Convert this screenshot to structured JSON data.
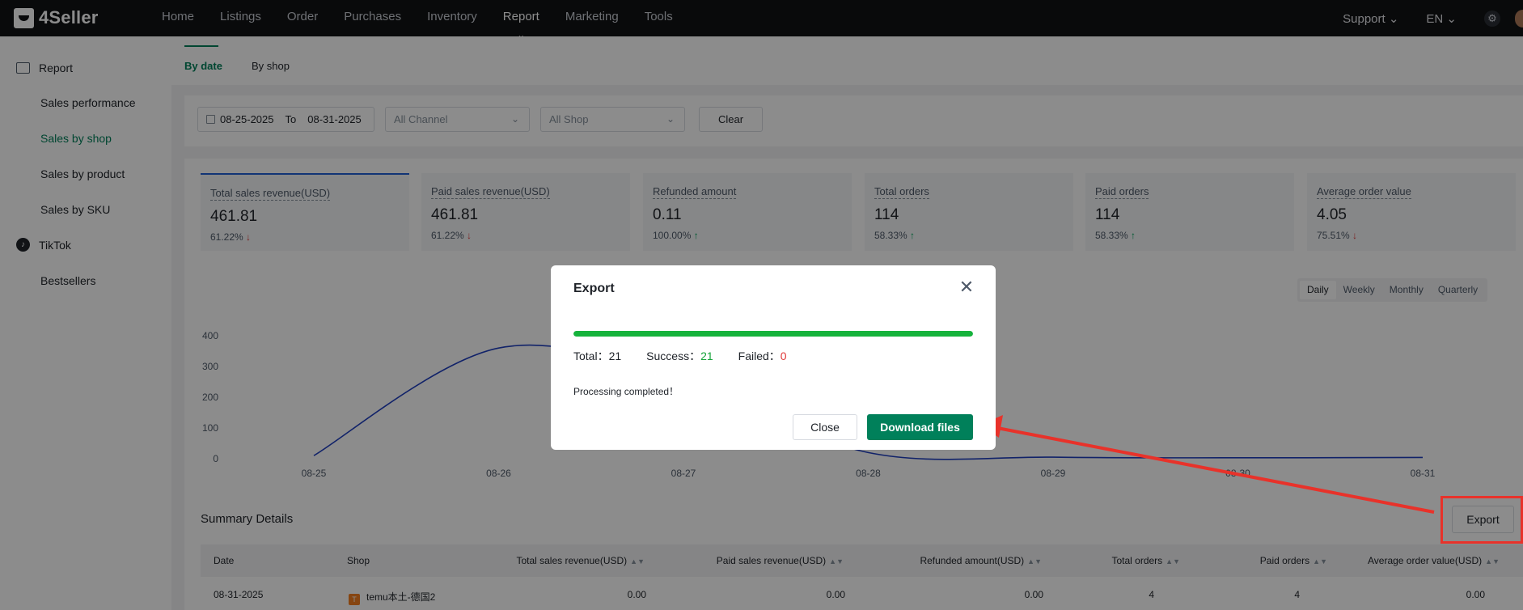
{
  "app": {
    "logo": "4Seller"
  },
  "nav": {
    "items": [
      "Home",
      "Listings",
      "Order",
      "Purchases",
      "Inventory",
      "Report",
      "Marketing",
      "Tools"
    ],
    "active": "Report",
    "support": "Support ⌄",
    "lang": "EN ⌄"
  },
  "sidebar": {
    "report_group": "Report",
    "items": [
      "Sales performance",
      "Sales by shop",
      "Sales by product",
      "Sales by SKU"
    ],
    "tiktok_group": "TikTok",
    "tiktok_items": [
      "Bestsellers"
    ],
    "active": "Sales by shop"
  },
  "tabs": [
    "By date",
    "By shop"
  ],
  "filters": {
    "date_from": "08-25-2025",
    "date_to_label": "To",
    "date_to": "08-31-2025",
    "channel": "All Channel",
    "shop": "All Shop",
    "clear": "Clear"
  },
  "cards": [
    {
      "title": "Total sales revenue(USD)",
      "value": "461.81",
      "pct": "61.22%",
      "trend": "↓",
      "dir": "down"
    },
    {
      "title": "Paid sales revenue(USD)",
      "value": "461.81",
      "pct": "61.22%",
      "trend": "↓",
      "dir": "down"
    },
    {
      "title": "Refunded amount",
      "value": "0.11",
      "pct": "100.00%",
      "trend": "↑",
      "dir": "up"
    },
    {
      "title": "Total orders",
      "value": "114",
      "pct": "58.33%",
      "trend": "↑",
      "dir": "up"
    },
    {
      "title": "Paid orders",
      "value": "114",
      "pct": "58.33%",
      "trend": "↑",
      "dir": "up"
    },
    {
      "title": "Average order value",
      "value": "4.05",
      "pct": "75.51%",
      "trend": "↓",
      "dir": "down"
    }
  ],
  "period": {
    "options": [
      "Daily",
      "Weekly",
      "Monthly",
      "Quarterly"
    ],
    "active": "Daily"
  },
  "chart_data": {
    "type": "line",
    "categories": [
      "08-25",
      "08-26",
      "08-27",
      "08-28",
      "08-29",
      "08-30",
      "08-31"
    ],
    "series": [
      {
        "values": [
          10,
          360,
          250,
          20,
          5,
          3,
          4
        ],
        "color": "#1f3fbf"
      }
    ],
    "yticks": [
      0,
      100,
      200,
      300,
      400
    ],
    "ylim": [
      0,
      400
    ],
    "grid": false
  },
  "summary": {
    "title": "Summary Details",
    "export": "Export",
    "columns": [
      "Date",
      "Shop",
      "Total sales revenue(USD)",
      "Paid sales revenue(USD)",
      "Refunded amount(USD)",
      "Total orders",
      "Paid orders",
      "Average order value(USD)"
    ],
    "rows": [
      {
        "date": "08-31-2025",
        "shop_badge": "T",
        "shop": "temu本土-德国2",
        "total": "0.00",
        "paid": "0.00",
        "refunded": "0.00",
        "total_orders": "4",
        "paid_orders": "4",
        "aov": "0.00"
      }
    ]
  },
  "modal": {
    "title": "Export",
    "progress": 1.0,
    "total_label": "Total：",
    "total": "21",
    "success_label": "Success：",
    "success": "21",
    "failed_label": "Failed：",
    "failed": "0",
    "message": "Processing completed！",
    "close": "Close",
    "download": "Download files"
  },
  "colors": {
    "brand": "#00805a",
    "progress": "#16b33c",
    "annotation": "#e8322a"
  }
}
